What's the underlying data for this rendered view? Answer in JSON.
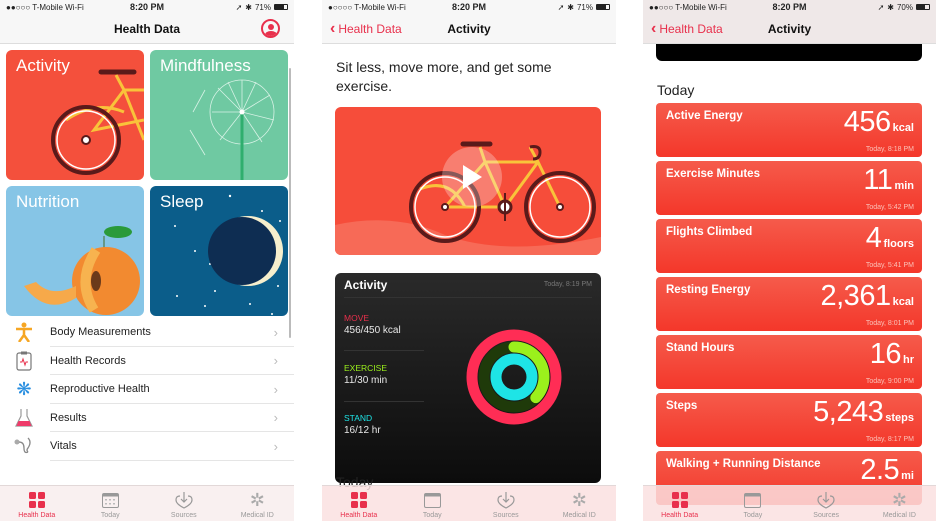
{
  "screens": [
    {
      "status": {
        "carrier": "T-Mobile Wi-Fi",
        "time": "8:20 PM",
        "battery": "71%",
        "battery_level": 0.71
      },
      "nav": {
        "title": "Health Data",
        "profile_icon": "person-circle-icon"
      },
      "tiles": [
        {
          "label": "Activity",
          "color": "#f4503c"
        },
        {
          "label": "Mindfulness",
          "color": "#6fc9a2"
        },
        {
          "label": "Nutrition",
          "color": "#86c5e6"
        },
        {
          "label": "Sleep",
          "color": "#0b5d8a"
        }
      ],
      "list": [
        {
          "label": "Body Measurements",
          "icon": "person-figure-icon"
        },
        {
          "label": "Health Records",
          "icon": "clipboard-ekg-icon"
        },
        {
          "label": "Reproductive Health",
          "icon": "snowflake-flower-icon"
        },
        {
          "label": "Results",
          "icon": "flask-icon"
        },
        {
          "label": "Vitals",
          "icon": "stethoscope-icon"
        }
      ]
    },
    {
      "status": {
        "carrier": "T-Mobile Wi-Fi",
        "time": "8:20 PM",
        "battery": "71%",
        "battery_level": 0.71
      },
      "nav": {
        "back": "Health Data",
        "title": "Activity"
      },
      "headline": "Sit less, move more, and get some exercise.",
      "activity_card": {
        "title": "Activity",
        "date": "Today, 8:19 PM",
        "stats": [
          {
            "label": "MOVE",
            "value": "456/450 kcal",
            "color": "#ff2d55",
            "progress": 1.01
          },
          {
            "label": "EXERCISE",
            "value": "11/30 min",
            "color": "#9bf01c",
            "progress": 0.37
          },
          {
            "label": "STAND",
            "value": "16/12 hr",
            "color": "#1ee4e6",
            "progress": 1.33
          }
        ]
      },
      "today_label": "Today"
    },
    {
      "status": {
        "carrier": "T-Mobile Wi-Fi",
        "time": "8:20 PM",
        "battery": "70%",
        "battery_level": 0.7
      },
      "nav": {
        "back": "Health Data",
        "title": "Activity"
      },
      "today_label": "Today",
      "metrics": [
        {
          "title": "Active Energy",
          "value": "456",
          "unit": "kcal",
          "date": "Today, 8:18 PM"
        },
        {
          "title": "Exercise Minutes",
          "value": "11",
          "unit": "min",
          "date": "Today, 5:42 PM"
        },
        {
          "title": "Flights Climbed",
          "value": "4",
          "unit": "floors",
          "date": "Today, 5:41 PM"
        },
        {
          "title": "Resting Energy",
          "value": "2,361",
          "unit": "kcal",
          "date": "Today, 8:01 PM"
        },
        {
          "title": "Stand Hours",
          "value": "16",
          "unit": "hr",
          "date": "Today, 9:00 PM"
        },
        {
          "title": "Steps",
          "value": "5,243",
          "unit": "steps",
          "date": "Today, 8:17 PM"
        },
        {
          "title": "Walking + Running Distance",
          "value": "2.5",
          "unit": "mi",
          "date": ""
        }
      ]
    }
  ],
  "tabbar": [
    {
      "label": "Health Data",
      "icon": "grid-icon",
      "active": true
    },
    {
      "label": "Today",
      "icon": "calendar-icon",
      "active": false
    },
    {
      "label": "Sources",
      "icon": "download-heart-icon",
      "active": false
    },
    {
      "label": "Medical ID",
      "icon": "asterisk-icon",
      "active": false
    }
  ],
  "colors": {
    "accent": "#e8304c",
    "metric_card": "#f4472f"
  }
}
